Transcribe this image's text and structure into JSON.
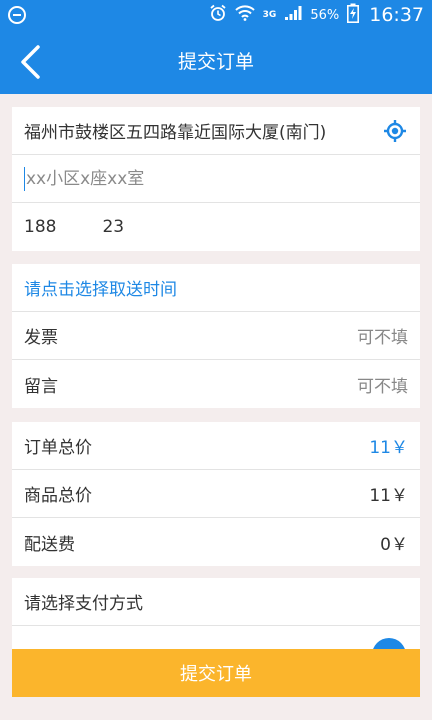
{
  "status_bar": {
    "network": "3G",
    "battery": "56%",
    "time": "16:37"
  },
  "header": {
    "title": "提交订单"
  },
  "address": {
    "location": "福州市鼓楼区五四路靠近国际大厦(南门)",
    "detail_placeholder": "xx小区x座xx室",
    "phone_start": "188",
    "phone_end": "23"
  },
  "options": {
    "pickup_time": "请点击选择取送时间",
    "invoice_label": "发票",
    "invoice_value": "可不填",
    "message_label": "留言",
    "message_value": "可不填"
  },
  "summary": {
    "order_total_label": "订单总价",
    "order_total_value": "11￥",
    "goods_total_label": "商品总价",
    "goods_total_value": "11￥",
    "delivery_fee_label": "配送费",
    "delivery_fee_value": "0￥"
  },
  "payment": {
    "title": "请选择支付方式"
  },
  "submit": {
    "label": "提交订单"
  },
  "colors": {
    "primary": "#1e88e5",
    "submit": "#fbb52c",
    "background": "#f4eded"
  }
}
